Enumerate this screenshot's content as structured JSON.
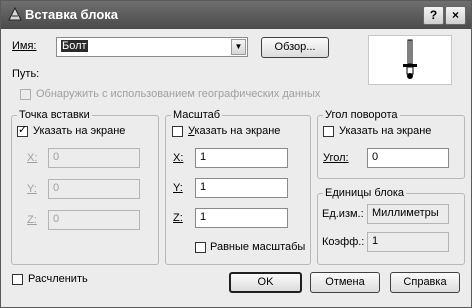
{
  "window": {
    "title": "Вставка блока",
    "help_glyph": "?",
    "close_glyph": "×"
  },
  "name": {
    "label": "Имя:",
    "value": "Болт",
    "browse_label": "Обзор..."
  },
  "path": {
    "label": "Путь:",
    "value": ""
  },
  "geo": {
    "label": "Обнаружить с использованием географических данных",
    "checked": false,
    "enabled": false
  },
  "insertion_point": {
    "title": "Точка вставки",
    "specify_label": "Указать на экране",
    "specify_checked": true,
    "x_label": "X:",
    "x_value": "0",
    "y_label": "Y:",
    "y_value": "0",
    "z_label": "Z:",
    "z_value": "0"
  },
  "scale": {
    "title": "Масштаб",
    "specify_label": "Указать на экране",
    "specify_checked": false,
    "x_label": "X:",
    "x_value": "1",
    "y_label": "Y:",
    "y_value": "1",
    "z_label": "Z:",
    "z_value": "1",
    "uniform_label": "Равные масштабы",
    "uniform_checked": false
  },
  "rotation": {
    "title": "Угол поворота",
    "specify_label": "Указать на экране",
    "specify_checked": false,
    "angle_label": "Угол:",
    "angle_value": "0"
  },
  "block_unit": {
    "title": "Единицы блока",
    "unit_label": "Ед.изм.:",
    "unit_value": "Миллиметры",
    "factor_label": "Коэфф.:",
    "factor_value": "1"
  },
  "explode": {
    "label": "Расчленить",
    "checked": false
  },
  "buttons": {
    "ok": "OK",
    "cancel": "Отмена",
    "help": "Справка"
  },
  "check_glyph": "✓",
  "dropdown_glyph": "▼"
}
